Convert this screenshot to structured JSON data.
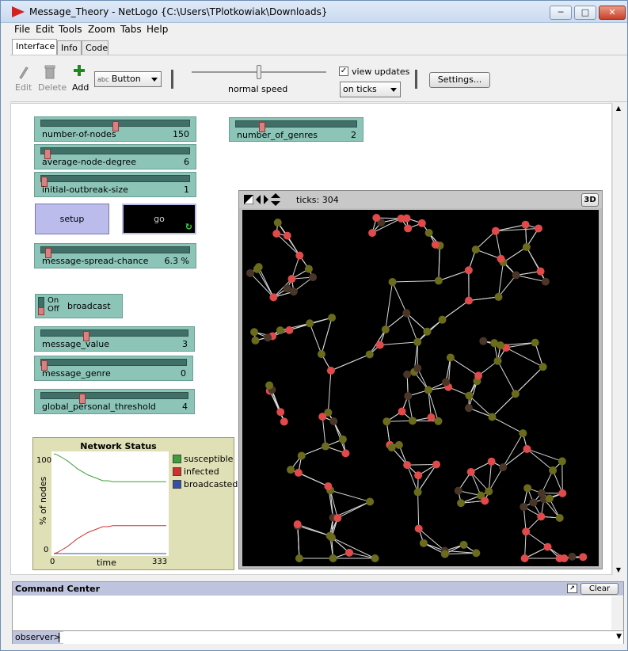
{
  "window": {
    "title": "Message_Theory - NetLogo {C:\\Users\\TPlotkowiak\\Downloads}",
    "minimize": "─",
    "maximize": "□",
    "close": "✕"
  },
  "menu": [
    "File",
    "Edit",
    "Tools",
    "Zoom",
    "Tabs",
    "Help"
  ],
  "tabs": [
    {
      "label": "Interface",
      "active": true
    },
    {
      "label": "Info",
      "active": false
    },
    {
      "label": "Code",
      "active": false
    }
  ],
  "toolbar": {
    "edit": "Edit",
    "delete": "Delete",
    "add": "Add",
    "widget_icon_text": "abc",
    "widget_type": "Button",
    "speed_label": "normal speed",
    "speed_value": 0.5,
    "view_updates_label": "view updates",
    "view_updates_checked": true,
    "update_mode": "on ticks",
    "settings": "Settings..."
  },
  "sliders": [
    {
      "name": "number-of-nodes",
      "value": "150",
      "position": 0.5
    },
    {
      "name": "average-node-degree",
      "value": "6",
      "position": 0.02
    },
    {
      "name": "initial-outbreak-size",
      "value": "1",
      "position": 0.0
    },
    {
      "name": "message-spread-chance",
      "value": "6.3 %",
      "position": 0.03
    },
    {
      "name": "message_value",
      "value": "3",
      "position": 0.3
    },
    {
      "name": "message_genre",
      "value": "0",
      "position": 0.0
    },
    {
      "name": "global_personal_threshold",
      "value": "4",
      "position": 0.27
    },
    {
      "name": "number_of_genres",
      "value": "2",
      "position": 0.2
    }
  ],
  "buttons": {
    "setup": "setup",
    "go": "go"
  },
  "switch": {
    "name": "broadcast",
    "on_label": "On",
    "off_label": "Off",
    "state": "off"
  },
  "plot": {
    "title": "Network Status",
    "ylabel": "% of nodes",
    "xlabel": "time",
    "y_max_label": "100",
    "y_min_label": "0",
    "x_min_label": "0",
    "x_max_label": "333",
    "legend": [
      {
        "name": "susceptible",
        "color": "#3aa03a"
      },
      {
        "name": "infected",
        "color": "#d23030"
      },
      {
        "name": "broadcasted",
        "color": "#3050b0"
      }
    ]
  },
  "chart_data": {
    "type": "line",
    "title": "Network Status",
    "xlabel": "time",
    "ylabel": "% of nodes",
    "xlim": [
      0,
      333
    ],
    "ylim": [
      0,
      100
    ],
    "legend": "right",
    "series": [
      {
        "name": "susceptible",
        "color": "#3aa03a",
        "x": [
          0,
          10,
          25,
          40,
          55,
          70,
          85,
          100,
          115,
          130,
          145,
          160,
          175,
          190,
          210,
          230,
          250,
          270,
          290,
          310,
          333
        ],
        "y": [
          100,
          99,
          96,
          93,
          89,
          85,
          82,
          79,
          77,
          75,
          73,
          73,
          72,
          72,
          72,
          72,
          72,
          72,
          72,
          72,
          72
        ]
      },
      {
        "name": "infected",
        "color": "#d23030",
        "x": [
          0,
          10,
          25,
          40,
          55,
          70,
          85,
          100,
          115,
          130,
          145,
          160,
          175,
          190,
          210,
          230,
          250,
          270,
          290,
          310,
          333
        ],
        "y": [
          0,
          1,
          4,
          7,
          11,
          15,
          18,
          21,
          23,
          25,
          27,
          27,
          28,
          28,
          28,
          28,
          28,
          28,
          28,
          28,
          28
        ]
      },
      {
        "name": "broadcasted",
        "color": "#3050b0",
        "x": [
          0,
          333
        ],
        "y": [
          0,
          0
        ]
      }
    ]
  },
  "view": {
    "ticks_label": "ticks: 304",
    "three_d": "3D"
  },
  "network": {
    "colors": {
      "susceptible": "#6b6b1c",
      "infected": "#e04a4a",
      "resistant": "#4a3628",
      "link": "#d9d9d9",
      "background": "#000000"
    },
    "seed": 1337,
    "node_count": 150
  },
  "command_center": {
    "title": "Command Center",
    "clear": "Clear",
    "prompt": "observer>",
    "input": ""
  }
}
